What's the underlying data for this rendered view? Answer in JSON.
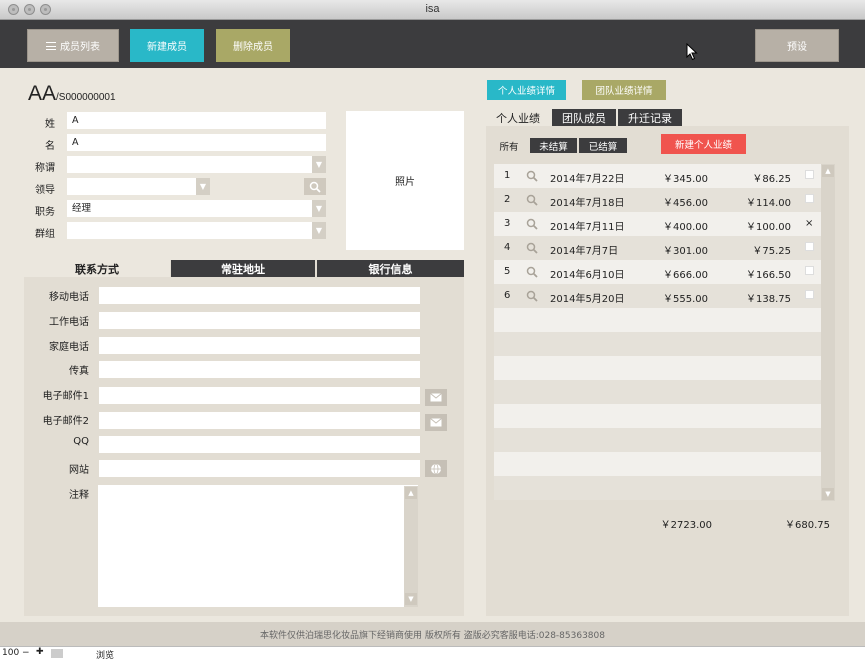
{
  "window": {
    "title": "isa"
  },
  "toolbar": {
    "member_list": "成员列表",
    "new_member": "新建成员",
    "delete_member": "删除成员",
    "preset": "预设"
  },
  "member": {
    "name_big": "AA",
    "code": "/S000000001",
    "labels": {
      "surname": "姓",
      "given": "名",
      "title": "称谓",
      "leader": "领导",
      "position": "职务",
      "group": "群组"
    },
    "surname": "A",
    "given": "A",
    "title": "",
    "leader": "",
    "position": "经理",
    "group": "",
    "photo_label": "照片"
  },
  "left_tabs": [
    "联系方式",
    "常驻地址",
    "银行信息"
  ],
  "contact": {
    "labels": [
      "移动电话",
      "工作电话",
      "家庭电话",
      "传真",
      "电子邮件1",
      "电子邮件2",
      "QQ",
      "网站",
      "注释"
    ]
  },
  "right": {
    "btn_personal_detail": "个人业绩详情",
    "btn_team_detail": "团队业绩详情",
    "tabs": [
      "个人业绩",
      "团队成员",
      "升迁记录"
    ],
    "filters": [
      "所有",
      "未结算",
      "已结算"
    ],
    "new_perf": "新建个人业绩",
    "rows": [
      {
        "num": "1",
        "date": "2014年7月22日",
        "amount": "￥345.00",
        "commission": "￥86.25",
        "mark": ""
      },
      {
        "num": "2",
        "date": "2014年7月18日",
        "amount": "￥456.00",
        "commission": "￥114.00",
        "mark": ""
      },
      {
        "num": "3",
        "date": "2014年7月11日",
        "amount": "￥400.00",
        "commission": "￥100.00",
        "mark": "×"
      },
      {
        "num": "4",
        "date": "2014年7月7日",
        "amount": "￥301.00",
        "commission": "￥75.25",
        "mark": ""
      },
      {
        "num": "5",
        "date": "2014年6月10日",
        "amount": "￥666.00",
        "commission": "￥166.50",
        "mark": ""
      },
      {
        "num": "6",
        "date": "2014年5月20日",
        "amount": "￥555.00",
        "commission": "￥138.75",
        "mark": ""
      }
    ],
    "total_amount": "￥2723.00",
    "total_commission": "￥680.75"
  },
  "footer": {
    "text": "本软件仅供泊瑞思化妆品旗下经销商使用 版权所有 盗版必究客服电话:028-85363808"
  },
  "statusbar": {
    "zoom": "100",
    "mode": "浏览"
  },
  "colors": {
    "toolbar": "#3c3c3e",
    "teal": "#29b8c8",
    "olive": "#a9a866",
    "red": "#f0544e",
    "background": "#ebe7de"
  }
}
